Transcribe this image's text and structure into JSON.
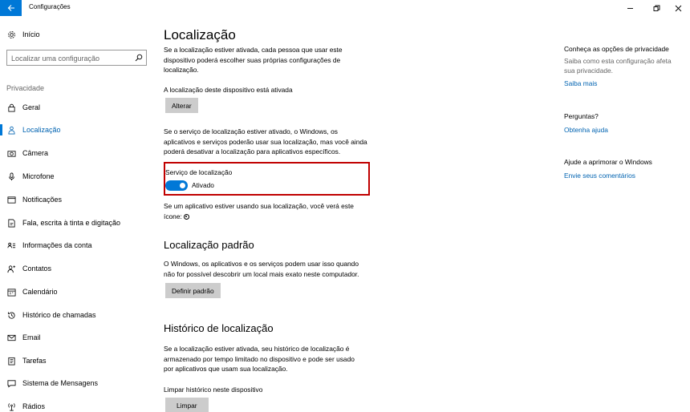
{
  "window": {
    "title": "Configurações"
  },
  "sidebar": {
    "home_label": "Início",
    "search_placeholder": "Localizar uma configuração",
    "section_heading": "Privacidade",
    "items": [
      {
        "label": "Geral",
        "icon": "lock-icon"
      },
      {
        "label": "Localização",
        "icon": "person-location-icon",
        "active": true
      },
      {
        "label": "Câmera",
        "icon": "camera-icon"
      },
      {
        "label": "Microfone",
        "icon": "microphone-icon"
      },
      {
        "label": "Notificações",
        "icon": "notification-icon"
      },
      {
        "label": "Fala, escrita à tinta e digitação",
        "icon": "document-pen-icon"
      },
      {
        "label": "Informações da conta",
        "icon": "account-info-icon"
      },
      {
        "label": "Contatos",
        "icon": "contacts-icon"
      },
      {
        "label": "Calendário",
        "icon": "calendar-icon"
      },
      {
        "label": "Histórico de chamadas",
        "icon": "history-icon"
      },
      {
        "label": "Email",
        "icon": "mail-icon"
      },
      {
        "label": "Tarefas",
        "icon": "tasks-icon"
      },
      {
        "label": "Sistema de Mensagens",
        "icon": "messaging-icon"
      },
      {
        "label": "Rádios",
        "icon": "radio-icon"
      }
    ]
  },
  "main": {
    "title": "Localização",
    "intro_line1": "Se a localização estiver ativada, cada pessoa que usar este",
    "intro_line2": "dispositivo poderá escolher suas próprias configurações de",
    "intro_line3": "localização.",
    "device_status": "A localização deste dispositivo está ativada",
    "change_button": "Alterar",
    "service_line1": "Se o serviço de localização estiver ativado, o Windows, os",
    "service_line2": "aplicativos e serviços poderão usar sua localização, mas você ainda",
    "service_line3": "poderá desativar a localização para aplicativos específicos.",
    "toggle_title": "Serviço de localização",
    "toggle_state": "Ativado",
    "toggle_on": true,
    "icon_note_line1": "Se um aplicativo estiver usando sua localização, você verá este",
    "icon_note_line2": "ícone:",
    "default_heading": "Localização padrão",
    "default_line1": "O Windows, os aplicativos e os serviços podem usar isso quando",
    "default_line2": "não for possível descobrir um local mais exato neste computador.",
    "default_button": "Definir padrão",
    "history_heading": "Histórico de localização",
    "history_line1": "Se a localização estiver ativada, seu histórico de localização é",
    "history_line2": "armazenado por tempo limitado no dispositivo e pode ser usado",
    "history_line3": "por aplicativos que usam sua localização.",
    "clear_label": "Limpar histórico neste dispositivo",
    "clear_button": "Limpar"
  },
  "right": {
    "privacy_heading": "Conheça as opções de privacidade",
    "privacy_line1": "Saiba como esta configuração afeta",
    "privacy_line2": "sua privacidade.",
    "privacy_link": "Saiba mais",
    "questions_heading": "Perguntas?",
    "questions_link": "Obtenha ajuda",
    "improve_heading": "Ajude a aprimorar o Windows",
    "improve_link": "Envie seus comentários"
  },
  "colors": {
    "accent": "#0078d7",
    "link": "#0063b1",
    "highlight": "#c00000",
    "button": "#cccccc"
  }
}
